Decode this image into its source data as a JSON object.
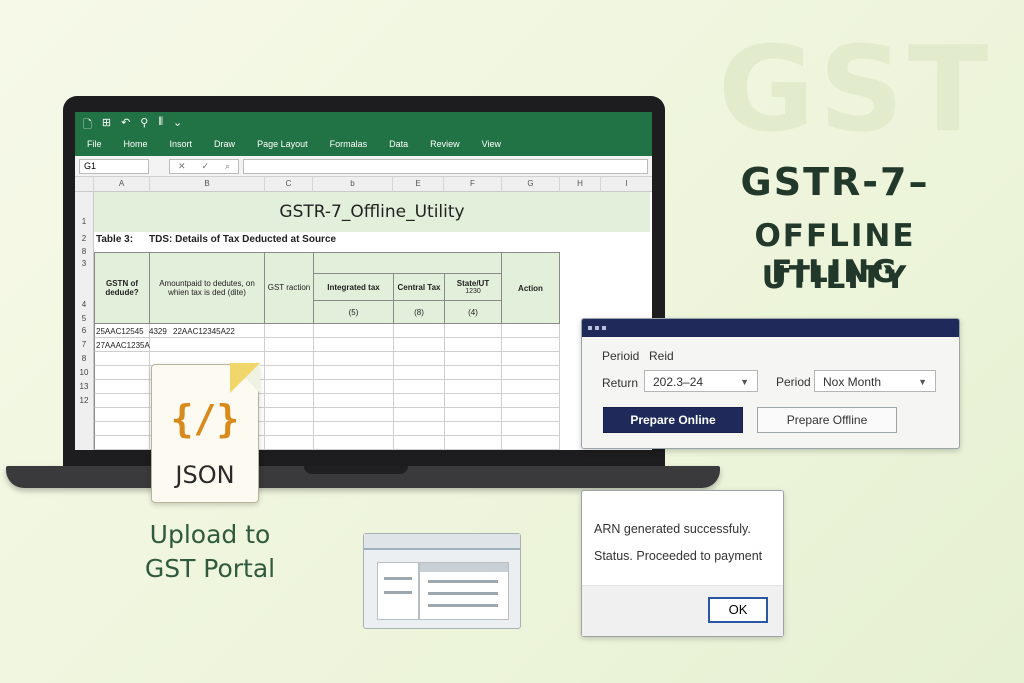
{
  "watermark": "GST",
  "headline": {
    "line1": "GSTR-7–",
    "line2": "OFFLINE FILING",
    "line3": "UTILITY"
  },
  "excel": {
    "menu": [
      "File",
      "Home",
      "Insort",
      "Draw",
      "Page Layout",
      "Formalas",
      "Data",
      "Review",
      "View"
    ],
    "name_box": "G1",
    "columns": [
      "A",
      "B",
      "C",
      "b",
      "E",
      "F",
      "G",
      "H",
      "I"
    ],
    "rows": [
      "1",
      "2",
      "8",
      "3",
      "4",
      "5",
      "6",
      "7",
      "8",
      "10",
      "13",
      "12"
    ],
    "title": "GSTR-7_Offline_Utility",
    "table_label": "Table 3:",
    "table_desc": "TDS:  Details of Tax Deducted at Source",
    "headers": {
      "gstn": "GSTN of dedude?",
      "amount": "Amountpaid to dedutes, on whien tax is ded (dite)",
      "gst_fraction": "GST raction",
      "integrated": "Integrated tax",
      "central": "Central Tax",
      "state": "State/UT",
      "state_sub": "1230",
      "integrated_num": "(5)",
      "central_num": "(8)",
      "state_num": "(4)",
      "action": "Action"
    },
    "row6_a": "25AAC12545",
    "row6_mid": "4329",
    "row6_b": "22AAC12345A22",
    "row7_a": "27AAAC1235A"
  },
  "json_file": {
    "label": "JSON",
    "glyph": "{/}"
  },
  "upload_text": {
    "line1": "Upload to",
    "line2": "GST Portal"
  },
  "dialog": {
    "period_label": "Perioid",
    "period_value": "Reid",
    "return_label": "Return",
    "return_value": "202.3–24",
    "period2_label": "Period",
    "period2_value": "Nox Month",
    "prepare_online": "Prepare Online",
    "prepare_offline": "Prepare Offline"
  },
  "message": {
    "line1": "ARN generated successfuly.",
    "line2": "Status. Proceeded to payment",
    "ok": "OK"
  },
  "colors": {
    "excel_green": "#217346",
    "dialog_navy": "#1f2a5a",
    "json_orange": "#d98a1c"
  }
}
